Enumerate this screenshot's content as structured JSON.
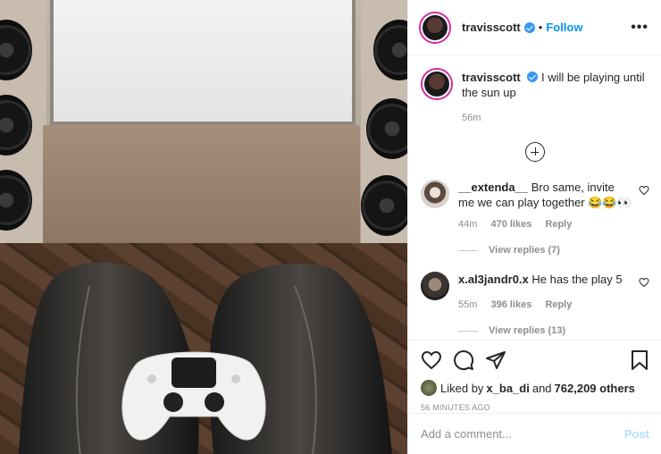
{
  "post": {
    "author": "travisscott",
    "follow_label": "Follow",
    "separator": "•",
    "more_label": "•••"
  },
  "caption": {
    "author": "travisscott",
    "text": "I will be playing until the sun up",
    "time": "56m"
  },
  "comments": [
    {
      "author": "__extenda__",
      "text": "Bro same, invite me we can play together 😂😂👀",
      "time": "44m",
      "likes": "470 likes",
      "reply_label": "Reply",
      "view_replies": "View replies (7)"
    },
    {
      "author": "x.al3jandr0.x",
      "text": "He has the play 5",
      "time": "55m",
      "likes": "396 likes",
      "reply_label": "Reply",
      "view_replies": "View replies (13)"
    }
  ],
  "likes": {
    "prefix": "Liked by",
    "user": "x_ba_di",
    "and": "and",
    "others": "762,209 others"
  },
  "timestamp": "56 MINUTES AGO",
  "add_comment": {
    "placeholder": "Add a comment...",
    "post_label": "Post"
  },
  "colors": {
    "accent": "#0095f6",
    "verified": "#3897f0",
    "muted": "#8e8e8e",
    "post_disabled": "#b2dffc"
  }
}
